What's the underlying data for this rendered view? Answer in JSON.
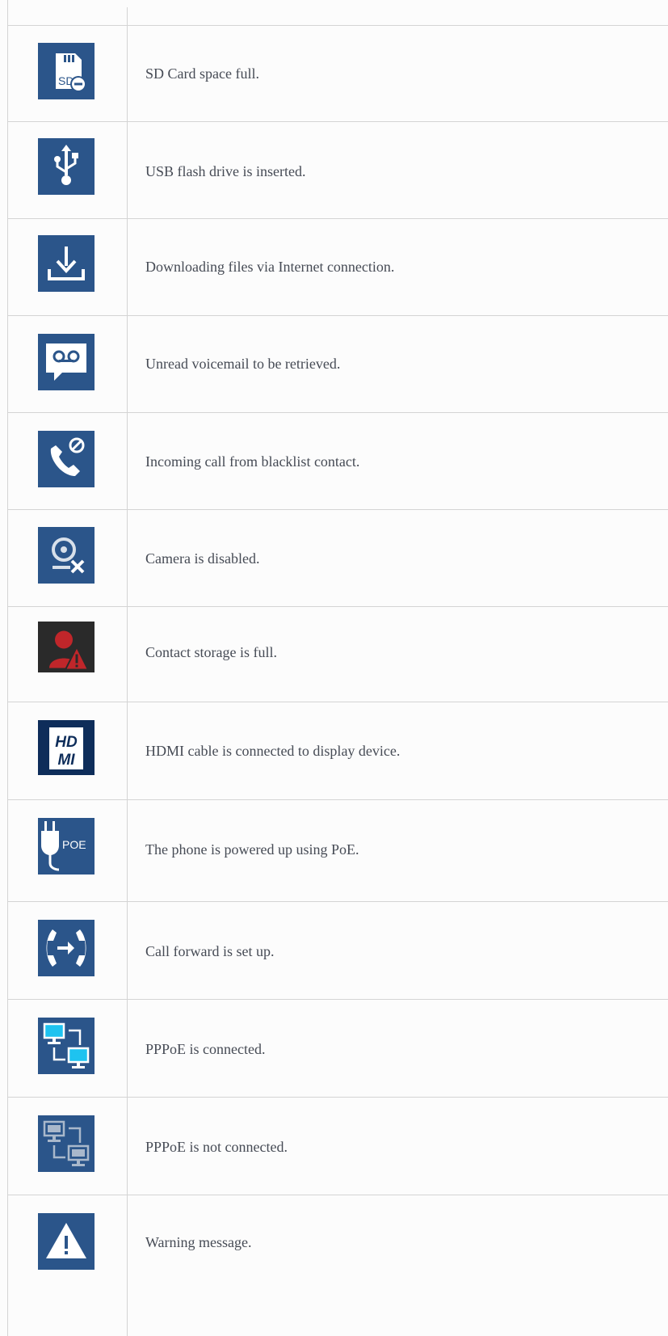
{
  "rows": [
    {
      "icon": "sd-card-full-icon",
      "description": "SD Card space full."
    },
    {
      "icon": "usb-icon",
      "description": "USB flash drive is inserted."
    },
    {
      "icon": "download-icon",
      "description": "Downloading files via Internet connection."
    },
    {
      "icon": "voicemail-icon",
      "description": "Unread voicemail to be retrieved."
    },
    {
      "icon": "blocked-call-icon",
      "description": "Incoming call from blacklist contact."
    },
    {
      "icon": "camera-disabled-icon",
      "description": "Camera is disabled."
    },
    {
      "icon": "contact-storage-full-icon",
      "description": "Contact storage is full."
    },
    {
      "icon": "hdmi-icon",
      "description": "HDMI cable is connected to display device.",
      "icon_text": "HD MI"
    },
    {
      "icon": "poe-icon",
      "description": "The phone is powered up using PoE.",
      "icon_text": "POE"
    },
    {
      "icon": "call-forward-icon",
      "description": "Call forward is set up."
    },
    {
      "icon": "pppoe-connected-icon",
      "description": "PPPoE is connected."
    },
    {
      "icon": "pppoe-disconnected-icon",
      "description": "PPPoE is not connected."
    },
    {
      "icon": "warning-icon",
      "description": "Warning message."
    }
  ],
  "colors": {
    "icon_background": "#2b558a",
    "warning_red": "#c0262a",
    "connected_cyan": "#1ec3f0",
    "text": "#464b55",
    "border": "#d4d4d4"
  }
}
